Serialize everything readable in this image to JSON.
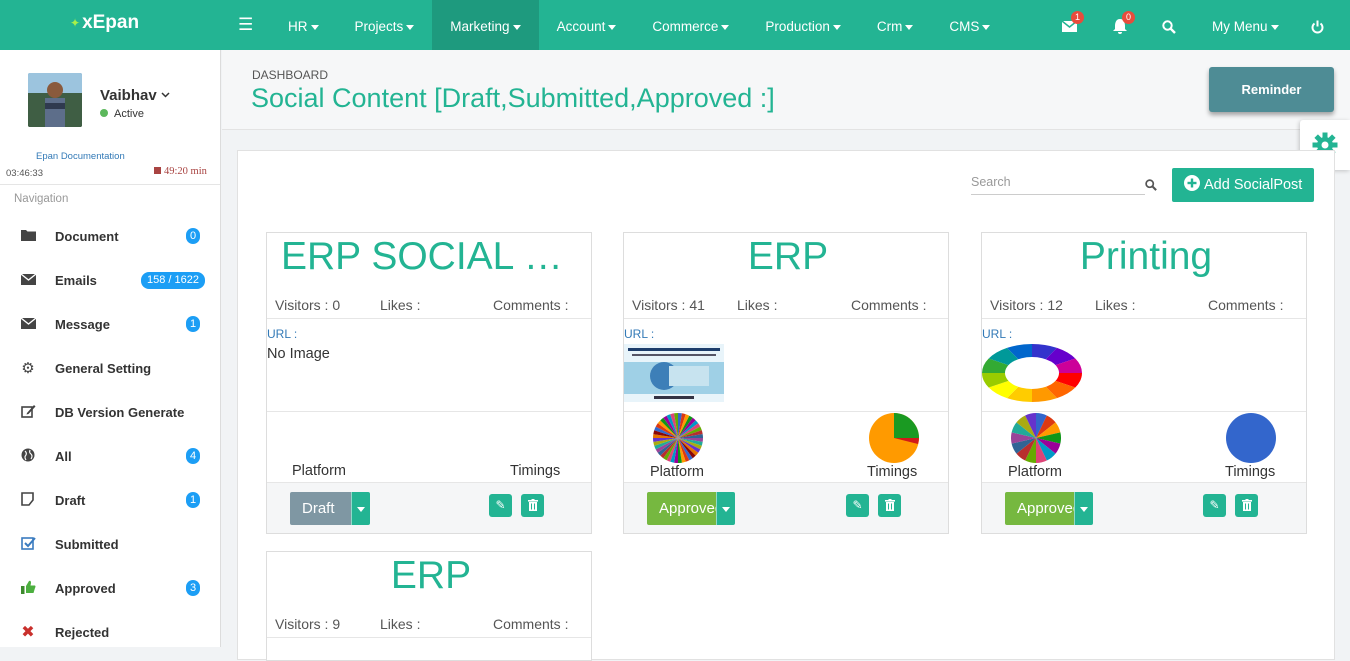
{
  "brand": {
    "name": "xEpan"
  },
  "topnav": {
    "items": [
      "HR",
      "Projects",
      "Marketing",
      "Account",
      "Commerce",
      "Production",
      "Crm",
      "CMS"
    ],
    "active": "Marketing",
    "mail_badge": "1",
    "bell_badge": "0",
    "mymenu": "My Menu"
  },
  "user": {
    "name": "Vaibhav",
    "status": "Active",
    "doc_link": "Epan Documentation",
    "clock": "03:46:33",
    "timer": "49:20 min"
  },
  "sidebar": {
    "heading": "Navigation",
    "items": [
      {
        "label": "Document",
        "badge": "0",
        "icon": "folder-icon"
      },
      {
        "label": "Emails",
        "badge": "158 / 1622",
        "icon": "envelope-icon"
      },
      {
        "label": "Message",
        "badge": "1",
        "icon": "envelope-icon"
      },
      {
        "label": "General Setting",
        "badge": "",
        "icon": "gear-icon"
      },
      {
        "label": "DB Version Generate",
        "badge": "",
        "icon": "edit-icon"
      },
      {
        "label": "All",
        "badge": "4",
        "icon": "globe-icon"
      },
      {
        "label": "Draft",
        "badge": "1",
        "icon": "draft-icon"
      },
      {
        "label": "Submitted",
        "badge": "",
        "icon": "check-square-icon"
      },
      {
        "label": "Approved",
        "badge": "3",
        "icon": "thumbs-up-icon"
      },
      {
        "label": "Rejected",
        "badge": "",
        "icon": "times-icon"
      }
    ]
  },
  "header": {
    "breadcrumb": "DASHBOARD",
    "title": "Social Content [Draft,Submitted,Approved :]",
    "reminder": "Reminder"
  },
  "toolbar": {
    "search_placeholder": "Search",
    "add_button": "Add SocialPost"
  },
  "cards": [
    {
      "title": "ERP SOCIAL POST",
      "visitors": "Visitors : 0",
      "likes": "Likes :",
      "comments": "Comments :",
      "url": "URL :",
      "image_text": "No Image",
      "platform": "Platform",
      "timings": "Timings",
      "status": "Draft",
      "status_color": "#7f97a3"
    },
    {
      "title": "ERP",
      "visitors": "Visitors : 41",
      "likes": "Likes :",
      "comments": "Comments :",
      "url": "URL :",
      "platform": "Platform",
      "timings": "Timings",
      "status": "Approved",
      "status_color": "#76b840"
    },
    {
      "title": "Printing",
      "visitors": "Visitors : 12",
      "likes": "Likes :",
      "comments": "Comments :",
      "url": "URL :",
      "platform": "Platform",
      "timings": "Timings",
      "status": "Approved",
      "status_color": "#76b840"
    },
    {
      "title": "ERP",
      "visitors": "Visitors : 9",
      "likes": "Likes :",
      "comments": "Comments :"
    }
  ],
  "colors": {
    "accent": "#23b493",
    "badge": "#1c9ef5",
    "alert": "#e74c3c"
  }
}
